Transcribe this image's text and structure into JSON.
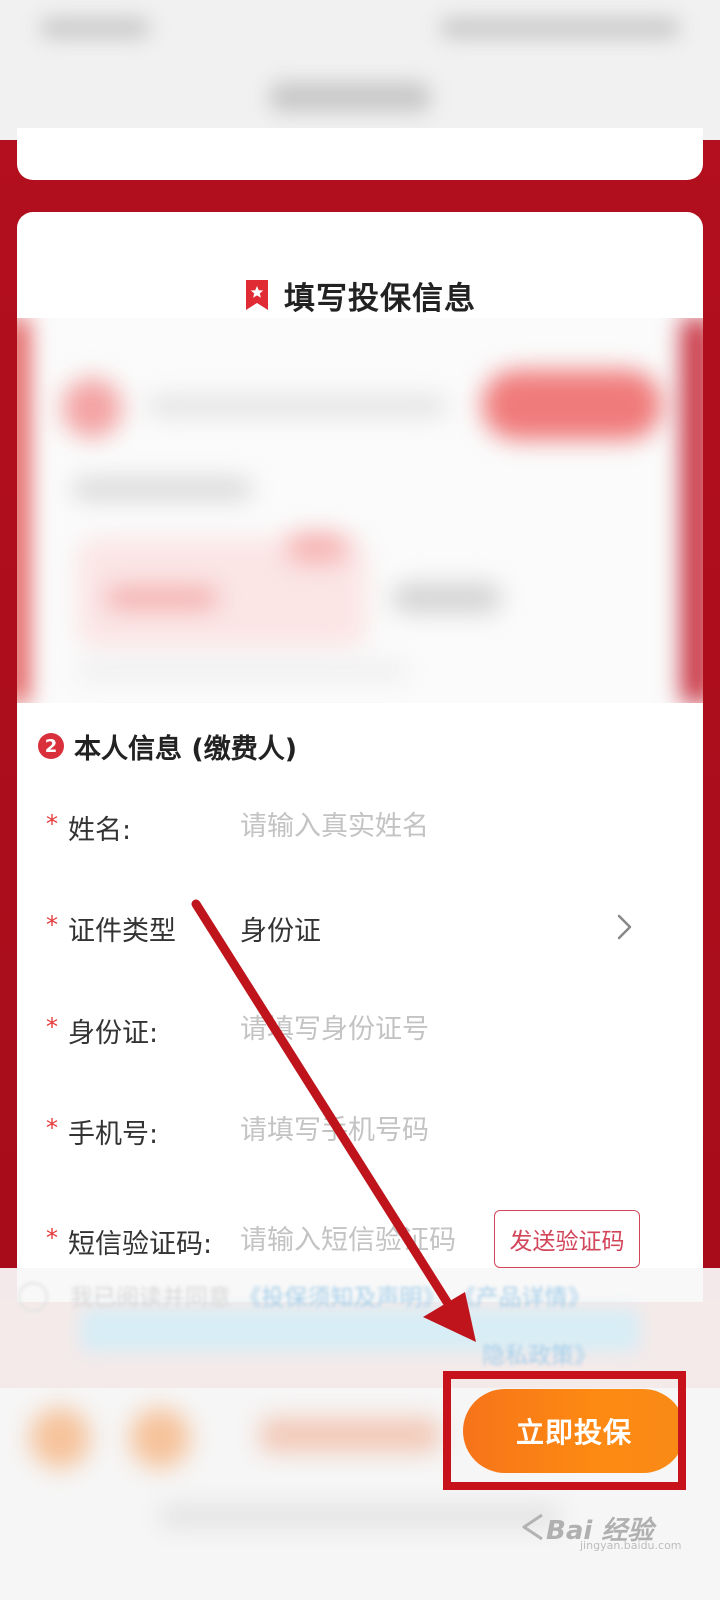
{
  "form_section": {
    "title": "填写投保信息"
  },
  "personal_info": {
    "step_number": "2",
    "title": "本人信息 (缴费人)",
    "fields": [
      {
        "label": "姓名:",
        "placeholder": "请输入真实姓名"
      },
      {
        "label": "证件类型",
        "value": "身份证"
      },
      {
        "label": "身份证:",
        "placeholder": "请填写身份证号"
      },
      {
        "label": "手机号:",
        "placeholder": "请填写手机号码"
      },
      {
        "label": "短信验证码:",
        "placeholder": "请输入短信验证码"
      }
    ],
    "required_mark": "*",
    "send_code_label": "发送验证码"
  },
  "agreement": {
    "text": "我已阅读并同意",
    "link1": "《投保须知及声明》",
    "link2": "《产品详情》",
    "link3": "隐私政策》"
  },
  "bottom_bar": {
    "buy_label": "立即投保"
  },
  "watermark": {
    "text": "Bai 经验",
    "sub": "jingyan.baidu.com"
  },
  "colors": {
    "page_red": "#b0111f",
    "accent_orange": "#fd8a12",
    "required_red": "#e23a3a",
    "highlight_box": "#c7121c"
  }
}
